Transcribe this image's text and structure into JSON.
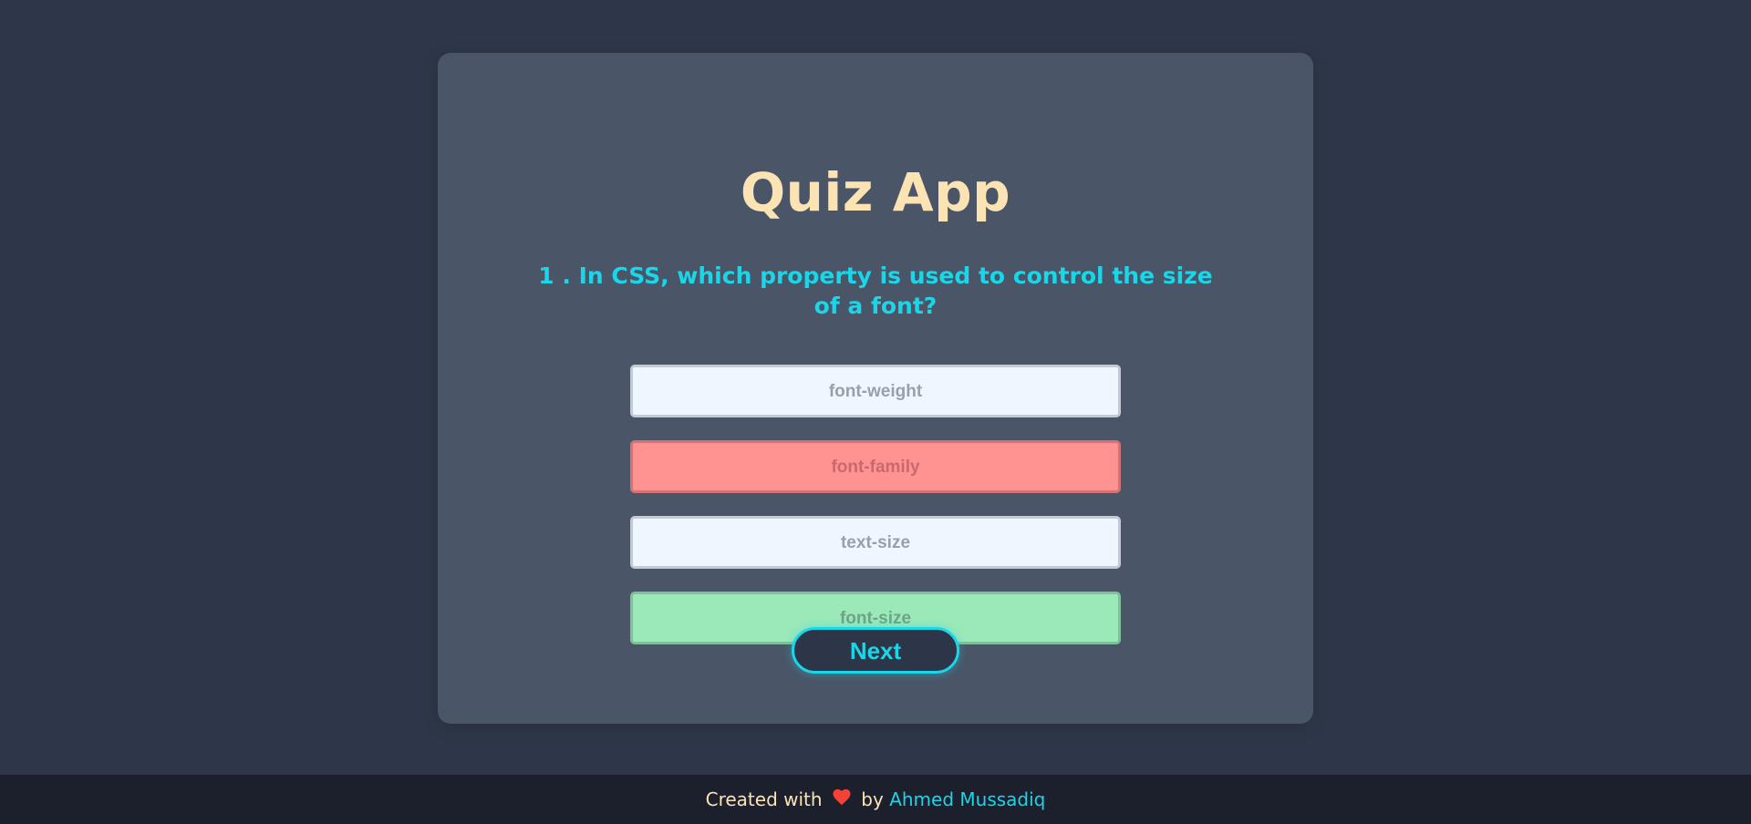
{
  "app": {
    "title": "Quiz App"
  },
  "question": {
    "number": "1",
    "text": "1 . In CSS, which property is used to control the size of a font?"
  },
  "answers": [
    {
      "label": "font-weight",
      "state": "neutral"
    },
    {
      "label": "font-family",
      "state": "wrong"
    },
    {
      "label": "text-size",
      "state": "neutral"
    },
    {
      "label": "font-size",
      "state": "correct"
    }
  ],
  "next_button": {
    "label": "Next"
  },
  "footer": {
    "prefix": "Created with",
    "heart_icon": "heart-icon",
    "by": "by",
    "author": "Ahmed Mussadiq"
  },
  "colors": {
    "background": "#2e3749",
    "card": "#4a5568",
    "title": "#fbe3b4",
    "accent": "#1bd5e8",
    "wrong": "#ff9392",
    "correct": "#9be9b9",
    "neutral": "#eef6ff",
    "heart": "#f44336"
  }
}
